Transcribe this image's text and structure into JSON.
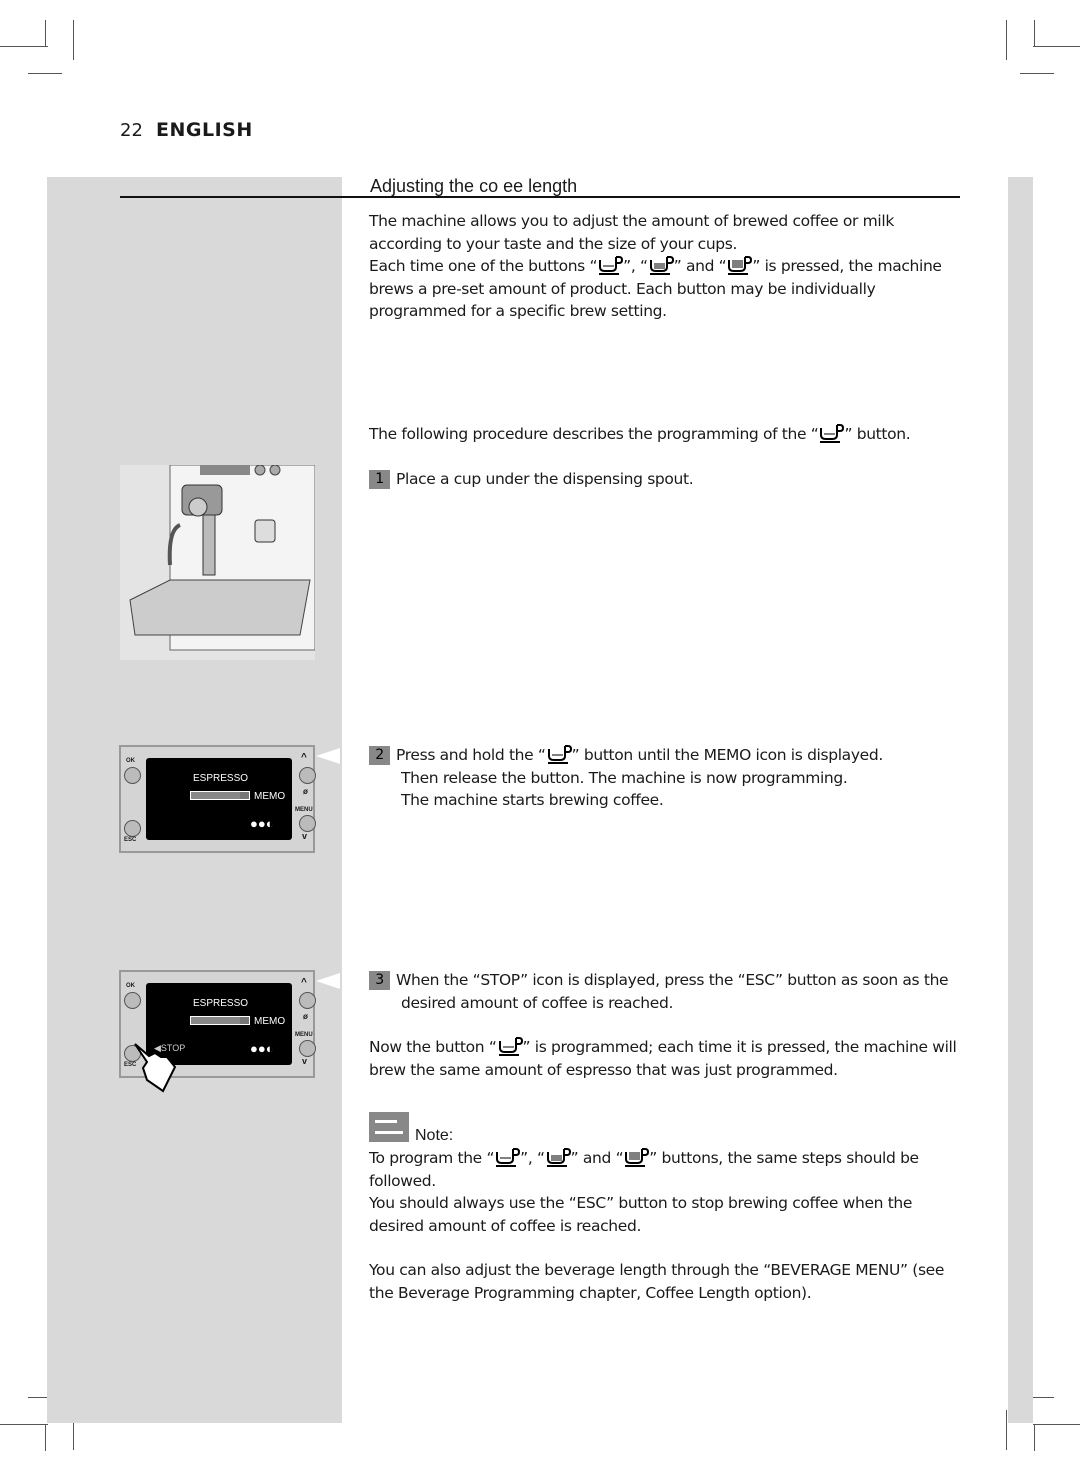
{
  "header": {
    "page_number": "22",
    "language": "ENGLISH"
  },
  "section": {
    "title": "Adjusting the co   ee length"
  },
  "intro": {
    "p1": "The machine allows you to adjust the amount of brewed coffee or milk according to your taste and the size of your cups.",
    "p2_a": "Each time one of the buttons “",
    "p2_b": "”, “",
    "p2_c": "” and “",
    "p2_d": "” is pressed, the machine brews a pre-set amount of product. Each button may be individually programmed for a specific brew setting."
  },
  "procedure": {
    "a": "The following procedure describes the programming of the “",
    "b": "” button."
  },
  "steps": [
    {
      "num": "1",
      "text": "Place a cup under the dispensing spout."
    },
    {
      "num": "2",
      "a": "Press and hold the “",
      "b": "” button until the  MEMO  icon is displayed.",
      "line2": "Then release the button. The machine is now programming.",
      "line3": "The machine starts brewing coffee."
    },
    {
      "num": "3",
      "text": "When the “STOP” icon is displayed, press the “ESC” button as soon as the desired amount of coffee is reached."
    }
  ],
  "programmed": {
    "a": "Now the button “",
    "b": "” is programmed; each time it is pressed, the machine will brew the same amount of espresso that was just programmed."
  },
  "note": {
    "label": "Note:",
    "a": "To program the “",
    "b": "”, “",
    "c": "” and “",
    "d": "” buttons, the same steps should be followed.",
    "p2": "You should always use the “ESC” button to stop brewing coffee when the desired amount of coffee is reached."
  },
  "footer_text": "You can also adjust the beverage length through the “BEVERAGE MENU” (see the Beverage Programming chapter, Coffee Length option).",
  "display_1": {
    "ok": "OK",
    "esc": "ESC",
    "menu": "MENU",
    "beverage": "ESPRESSO",
    "memo": "MEMO",
    "up": "^",
    "down": "v",
    "memo_progress": 0.85
  },
  "display_2": {
    "ok": "OK",
    "esc": "ESC",
    "menu": "MENU",
    "beverage": "ESPRESSO",
    "memo": "MEMO",
    "stop": "STOP",
    "up": "^",
    "down": "v",
    "memo_progress": 0.85
  },
  "icons": {
    "cup_small": "espresso-cup-icon",
    "cup_medium": "coffee-cup-icon",
    "cup_large": "long-coffee-cup-icon",
    "aroma": "coffee-beans-icon",
    "hand": "pointing-hand-icon",
    "note": "note-icon"
  },
  "colors": {
    "sidebar": "#d9d9d9",
    "step_badge": "#888888"
  }
}
